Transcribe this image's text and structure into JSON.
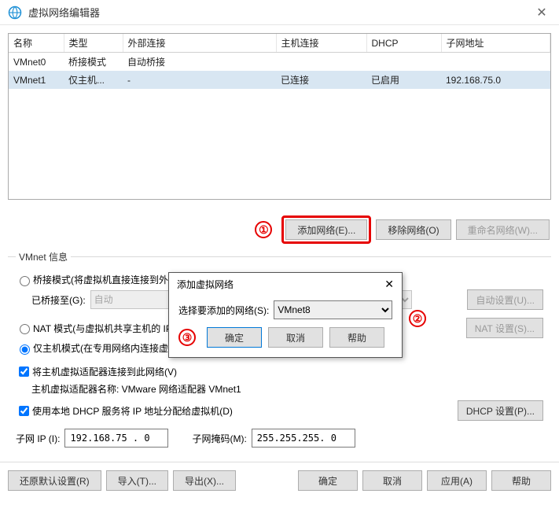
{
  "window": {
    "title": "虚拟网络编辑器"
  },
  "table": {
    "headers": [
      "名称",
      "类型",
      "外部连接",
      "主机连接",
      "DHCP",
      "子网地址"
    ],
    "rows": [
      {
        "name": "VMnet0",
        "type": "桥接模式",
        "ext": "自动桥接",
        "host": "",
        "dhcp": "",
        "subnet": ""
      },
      {
        "name": "VMnet1",
        "type": "仅主机...",
        "ext": "-",
        "host": "已连接",
        "dhcp": "已启用",
        "subnet": "192.168.75.0"
      }
    ]
  },
  "buttons": {
    "add_net": "添加网络(E)...",
    "remove_net": "移除网络(O)",
    "rename_net": "重命名网络(W)...",
    "auto_set": "自动设置(U)...",
    "nat_set": "NAT 设置(S)...",
    "dhcp_set": "DHCP 设置(P)...",
    "restore": "还原默认设置(R)",
    "import": "导入(T)...",
    "export": "导出(X)...",
    "ok": "确定",
    "cancel": "取消",
    "apply": "应用(A)",
    "help": "帮助"
  },
  "vmnet_info": {
    "legend": "VMnet 信息",
    "bridge_label": "桥接模式(将虚拟机直接连接到外部网络)(B)",
    "bridge_to": "已桥接至(G):",
    "bridge_select": "自动",
    "nat_label": "NAT 模式(与虚拟机共享主机的 IP 地址)(N)",
    "host_label": "仅主机模式(在专用网络内连接虚拟机)(H)",
    "connect_host": "将主机虚拟适配器连接到此网络(V)",
    "adapter_name_label": "主机虚拟适配器名称: VMware 网络适配器 VMnet1",
    "use_dhcp": "使用本地 DHCP 服务将 IP 地址分配给虚拟机(D)",
    "subnet_ip_label": "子网 IP (I):",
    "subnet_ip": "192.168.75 . 0",
    "subnet_mask_label": "子网掩码(M):",
    "subnet_mask": "255.255.255. 0"
  },
  "modal": {
    "title": "添加虚拟网络",
    "select_label": "选择要添加的网络(S):",
    "selected": "VMnet8",
    "ok": "确定",
    "cancel": "取消",
    "help": "帮助"
  },
  "annotations": {
    "a1": "①",
    "a2": "②",
    "a3": "③"
  }
}
